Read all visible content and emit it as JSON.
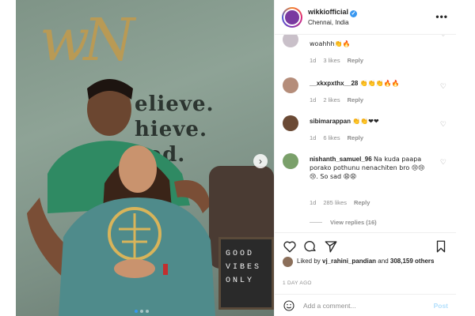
{
  "post": {
    "username": "wikkiofficial",
    "location": "Chennai, India",
    "more_label": "•••"
  },
  "photo": {
    "wall_logo": "wN",
    "wall_text": [
      "elieve.",
      "hieve.",
      "eed."
    ],
    "sign_text": [
      "GOOD",
      "VIBES",
      "ONLY"
    ],
    "next_arrow": "›"
  },
  "comments": [
    {
      "username": "",
      "text": "woahhh👏🔥",
      "emoji": "",
      "age": "1d",
      "likes": "3 likes",
      "reply": "Reply",
      "avatar_color": "#c9c0c9"
    },
    {
      "username": "__xkxpxthx__28",
      "text": "👏👏👏🔥🔥",
      "age": "1d",
      "likes": "2 likes",
      "reply": "Reply",
      "avatar_color": "#b58d7a"
    },
    {
      "username": "sibimarappan",
      "text": "👏👏❤❤",
      "age": "1d",
      "likes": "6 likes",
      "reply": "Reply",
      "avatar_color": "#6b4a35"
    },
    {
      "username": "nishanth_samuel_96",
      "text": "Na kuda paapa porako pothunu nenachiten bro 😢😢😢. So sad 😩😩",
      "age": "1d",
      "likes": "285 likes",
      "reply": "Reply",
      "avatar_color": "#7aa06a"
    }
  ],
  "view_replies": "View replies (16)",
  "actions": {
    "like_icon": "heart-icon",
    "comment_icon": "comment-icon",
    "share_icon": "share-icon",
    "save_icon": "bookmark-icon"
  },
  "likes": {
    "prefix": "Liked by",
    "user": "vj_rahini_pandian",
    "middle": "and",
    "others": "308,159 others"
  },
  "timestamp": "1 DAY AGO",
  "add_comment": {
    "placeholder": "Add a comment...",
    "post_label": "Post"
  },
  "colors": {
    "accent": "#3897f0",
    "post_disabled": "#b2dffc",
    "muted": "#8e8e8e"
  }
}
